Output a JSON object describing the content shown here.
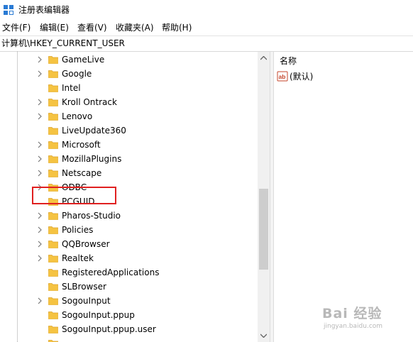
{
  "window": {
    "title": "注册表编辑器"
  },
  "menu": [
    "文件(F)",
    "编辑(E)",
    "查看(V)",
    "收藏夹(A)",
    "帮助(H)"
  ],
  "address": {
    "path": "计算机\\HKEY_CURRENT_USER"
  },
  "tree": {
    "items": [
      {
        "label": "GameLive",
        "expandable": true
      },
      {
        "label": "Google",
        "expandable": true
      },
      {
        "label": "Intel",
        "expandable": false
      },
      {
        "label": "Kroll Ontrack",
        "expandable": true
      },
      {
        "label": "Lenovo",
        "expandable": true
      },
      {
        "label": "LiveUpdate360",
        "expandable": false
      },
      {
        "label": "Microsoft",
        "expandable": true,
        "highlighted": true
      },
      {
        "label": "MozillaPlugins",
        "expandable": true
      },
      {
        "label": "Netscape",
        "expandable": true
      },
      {
        "label": "ODBC",
        "expandable": true
      },
      {
        "label": "PCGUID",
        "expandable": false
      },
      {
        "label": "Pharos-Studio",
        "expandable": true
      },
      {
        "label": "Policies",
        "expandable": true
      },
      {
        "label": "QQBrowser",
        "expandable": true
      },
      {
        "label": "Realtek",
        "expandable": true
      },
      {
        "label": "RegisteredApplications",
        "expandable": false
      },
      {
        "label": "SLBrowser",
        "expandable": false
      },
      {
        "label": "SogouInput",
        "expandable": true
      },
      {
        "label": "SogouInput.ppup",
        "expandable": false
      },
      {
        "label": "SogouInput.ppup.user",
        "expandable": false
      },
      {
        "label": "",
        "expandable": false
      }
    ]
  },
  "values_pane": {
    "column_name": "名称",
    "rows": [
      {
        "name": "(默认)",
        "icon": "string-value-icon"
      }
    ]
  },
  "watermark": {
    "main": "Bai 经验",
    "sub": "jingyan.baidu.com"
  },
  "colors": {
    "folder": "#f5c342",
    "folder_dark": "#dca42a",
    "highlight": "#e02020",
    "scroll_thumb": "#cdcdcd",
    "app_icon": "#2a7bd4",
    "value_icon": "#c4452b"
  }
}
